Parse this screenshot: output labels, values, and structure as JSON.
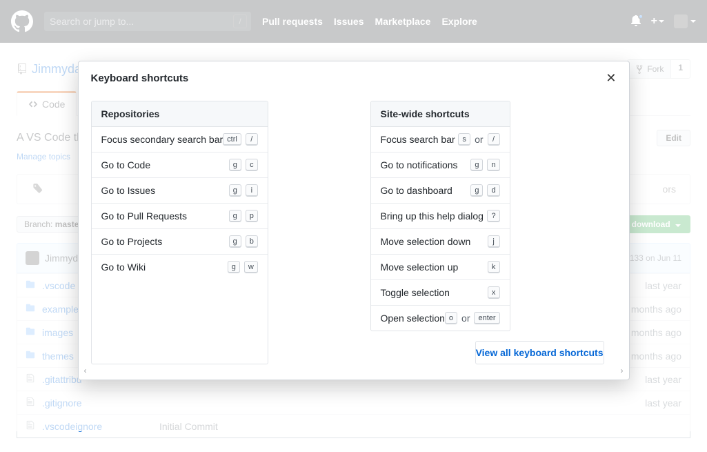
{
  "header": {
    "search_placeholder": "Search or jump to...",
    "slash_hint": "/",
    "nav": [
      "Pull requests",
      "Issues",
      "Marketplace",
      "Explore"
    ]
  },
  "repo": {
    "owner": "Jimmydal",
    "desc_prefix": "A VS Code th",
    "manage_topics": "Manage topics",
    "tab_code": "Code",
    "branch_label": "Branch:",
    "branch_name": "master",
    "clone_label": "or download",
    "edit_label": "Edit",
    "ors_text": "ors",
    "fork": {
      "label": "Fork",
      "count": "1"
    },
    "commit": {
      "author": "Jimmydal",
      "meta": "133 on Jun 11"
    },
    "files": [
      {
        "type": "dir",
        "name": ".vscode",
        "msg": "",
        "age": "last year"
      },
      {
        "type": "dir",
        "name": "examples",
        "msg": "",
        "age": "months ago"
      },
      {
        "type": "dir",
        "name": "images",
        "msg": "",
        "age": "months ago"
      },
      {
        "type": "dir",
        "name": "themes",
        "msg": "",
        "age": "months ago"
      },
      {
        "type": "file",
        "name": ".gitattribu",
        "msg": "",
        "age": "last year"
      },
      {
        "type": "file",
        "name": ".gitignore",
        "msg": "",
        "age": "last year"
      },
      {
        "type": "file",
        "name": ".vscodeignore",
        "msg": "Initial Commit",
        "age": ""
      }
    ]
  },
  "modal": {
    "title": "Keyboard shortcuts",
    "view_all": "View all keyboard shortcuts",
    "panels": [
      {
        "title": "Repositories",
        "rows": [
          {
            "label": "Focus secondary search bar",
            "keys": [
              "ctrl",
              "/"
            ]
          },
          {
            "label": "Go to Code",
            "keys": [
              "g",
              "c"
            ]
          },
          {
            "label": "Go to Issues",
            "keys": [
              "g",
              "i"
            ]
          },
          {
            "label": "Go to Pull Requests",
            "keys": [
              "g",
              "p"
            ]
          },
          {
            "label": "Go to Projects",
            "keys": [
              "g",
              "b"
            ]
          },
          {
            "label": "Go to Wiki",
            "keys": [
              "g",
              "w"
            ]
          }
        ]
      },
      {
        "title": "Site-wide shortcuts",
        "rows": [
          {
            "label": "Focus search bar",
            "keys": [
              "s"
            ],
            "or": "/"
          },
          {
            "label": "Go to notifications",
            "keys": [
              "g",
              "n"
            ]
          },
          {
            "label": "Go to dashboard",
            "keys": [
              "g",
              "d"
            ]
          },
          {
            "label": "Bring up this help dialog",
            "keys": [
              "?"
            ]
          },
          {
            "label": "Move selection down",
            "keys": [
              "j"
            ]
          },
          {
            "label": "Move selection up",
            "keys": [
              "k"
            ]
          },
          {
            "label": "Toggle selection",
            "keys": [
              "x"
            ]
          },
          {
            "label": "Open selection",
            "keys": [
              "o"
            ],
            "or": "enter"
          }
        ]
      }
    ]
  }
}
